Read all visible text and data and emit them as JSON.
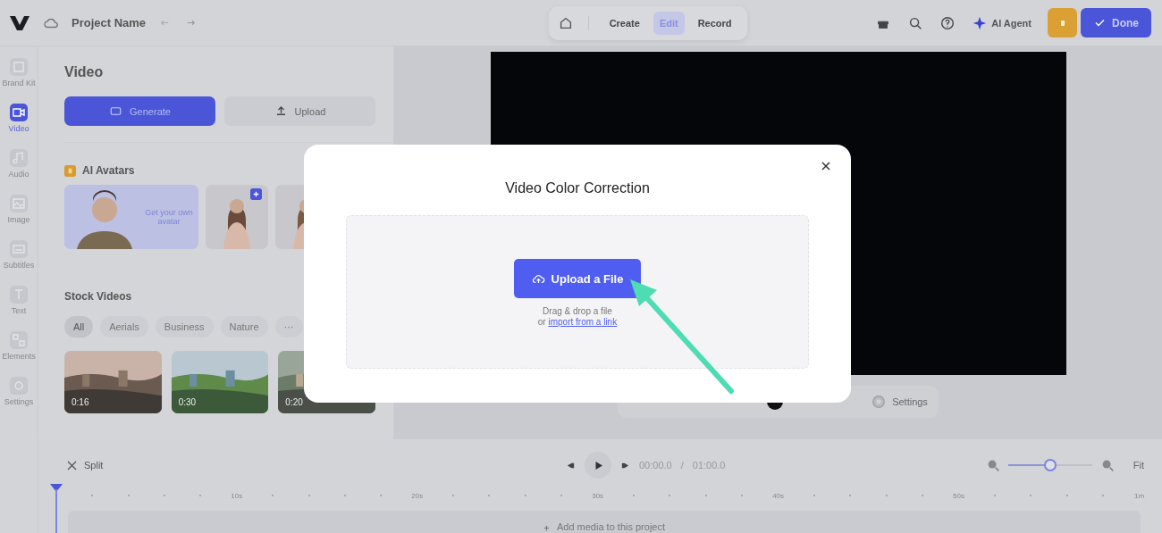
{
  "topbar": {
    "project_name": "Project Name",
    "modes": [
      {
        "label": "Create",
        "selected": false
      },
      {
        "label": "Edit",
        "selected": true
      },
      {
        "label": "Record",
        "selected": false
      }
    ],
    "ai_agent": "AI Agent",
    "done": "Done"
  },
  "sidebar": {
    "items": [
      {
        "label": "Brand Kit",
        "selected": false
      },
      {
        "label": "Video",
        "selected": true
      },
      {
        "label": "Audio",
        "selected": false
      },
      {
        "label": "Image",
        "selected": false
      },
      {
        "label": "Subtitles",
        "selected": false
      },
      {
        "label": "Text",
        "selected": false
      },
      {
        "label": "Elements",
        "selected": false
      },
      {
        "label": "Settings",
        "selected": false
      }
    ]
  },
  "panel": {
    "title": "Video",
    "actions": [
      {
        "label": "Generate",
        "kind": "primary"
      },
      {
        "label": "Upload",
        "kind": "secondary"
      }
    ],
    "avatars_title": "AI Avatars",
    "avatar_promo": "Get your own avatar",
    "stock_title": "Stock Videos",
    "filters": [
      {
        "label": "All",
        "selected": true
      },
      {
        "label": "Aerials",
        "selected": false
      },
      {
        "label": "Business",
        "selected": false
      },
      {
        "label": "Nature",
        "selected": false
      },
      {
        "label": "···",
        "selected": false
      }
    ],
    "videos": [
      {
        "duration": "0:16",
        "kind": "city"
      },
      {
        "duration": "0:30",
        "kind": "coast"
      },
      {
        "duration": "0:20",
        "kind": "street"
      }
    ]
  },
  "canvas_toolbar": {
    "settings": "Settings"
  },
  "timeline": {
    "split": "Split",
    "current": "00:00.0",
    "separator": "/",
    "total": "01:00.0",
    "zoom": {
      "level": 0.5
    },
    "fit": "Fit",
    "ruler": [
      "10s",
      "20s",
      "30s",
      "40s",
      "50s",
      "1m"
    ],
    "empty_track": "Add media to this project"
  },
  "modal": {
    "title": "Video Color Correction",
    "upload_button": "Upload a File",
    "hint": "Drag & drop a file",
    "link_prefix": "or",
    "link": "import from a link"
  }
}
